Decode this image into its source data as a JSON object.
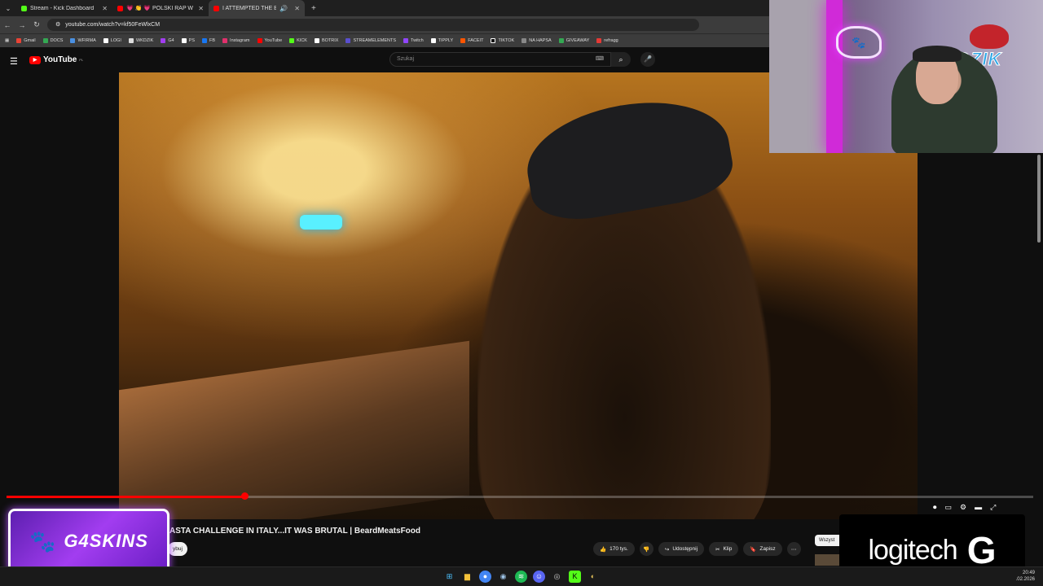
{
  "browser": {
    "tabs": [
      {
        "title": "Stream - Kick Dashboard",
        "color": "#53fc18",
        "active": false
      },
      {
        "title": "💗 👏 💗 POLSKI RAP W REMIX",
        "color": "#ff0000",
        "active": false
      },
      {
        "title": "I ATTEMPTED THE BIGGEST",
        "color": "#ff0000",
        "active": true
      }
    ],
    "url": "youtube.com/watch?v=kf50FeWlxCM",
    "bookmarks": [
      "Gmail",
      "DOCS",
      "WFIRMA",
      "LOGI",
      "WKDZIK",
      "G4",
      "PS",
      "FB",
      "Instagram",
      "YouTube",
      "KICK",
      "BOTRIX",
      "STREAMELEMENTS",
      "Twitch",
      "TIPPLY",
      "FACEIT",
      "TIKTOK",
      "NA HAPSA",
      "GIVEAWAY",
      "refragg"
    ]
  },
  "youtube": {
    "logo_text": "YouTube",
    "region": "PL",
    "search_placeholder": "Szukaj",
    "video_title": "ASTA CHALLENGE IN ITALY...IT WAS BRUTAL | BeardMeatsFood",
    "progress": 0.23,
    "subscribe_label": "ybuj",
    "likes": "170 tys.",
    "share_label": "Udostępnij",
    "clip_label": "Klip",
    "save_label": "Zapisz",
    "chip_label": "Wszyst"
  },
  "overlay": {
    "sponsor_left": "G4SKINS",
    "sponsor_right": "logitech",
    "cam_brand": "DZIK"
  },
  "taskbar": {
    "time": "20:49",
    "date": ".02.2026"
  },
  "colors": {
    "accent": "#ff0000",
    "kick": "#53fc18",
    "g4": "#a23df0"
  }
}
